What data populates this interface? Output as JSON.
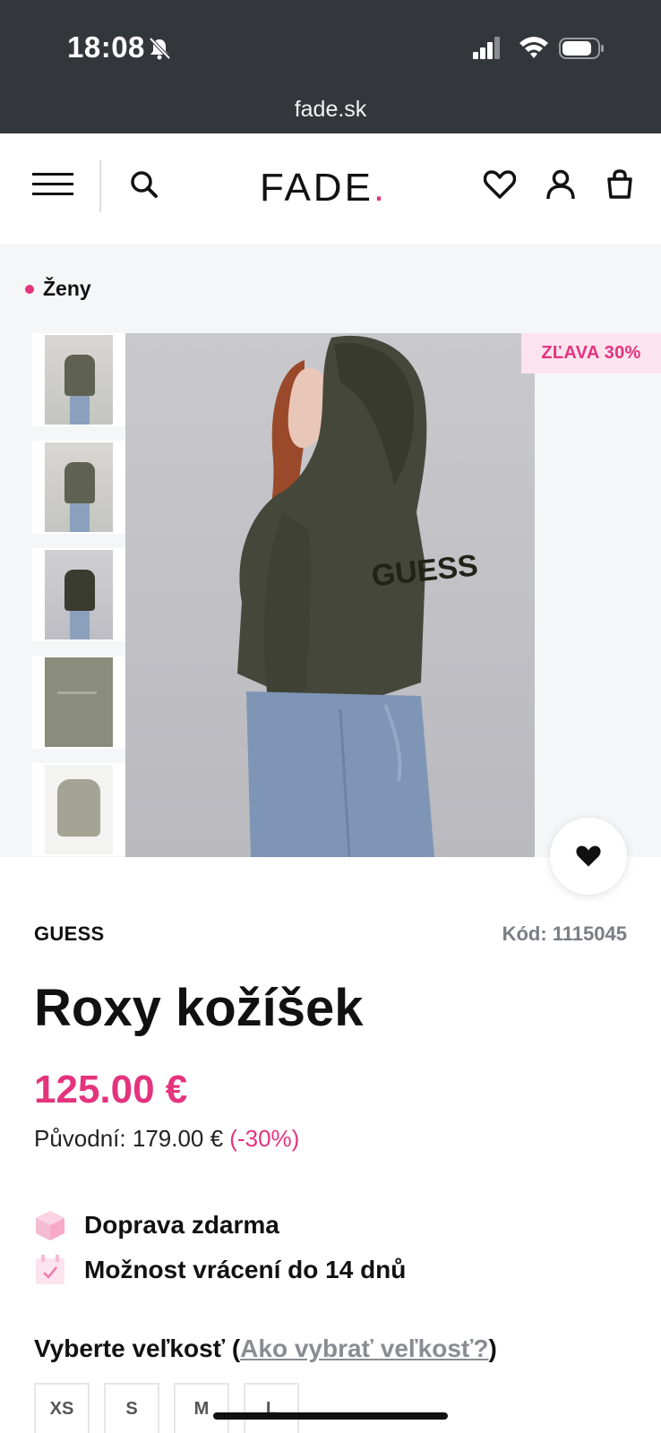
{
  "status_bar": {
    "time": "18:08",
    "url": "fade.sk",
    "icons": [
      "bell-muted-icon",
      "signal-icon",
      "wifi-icon",
      "battery-icon"
    ]
  },
  "header": {
    "logo_text": "FADE",
    "logo_dot": ".",
    "accent_color": "#e5337e",
    "icons": [
      "menu-icon",
      "search-icon",
      "heart-icon",
      "user-icon",
      "bag-icon"
    ]
  },
  "breadcrumb": {
    "label": "Ženy"
  },
  "gallery": {
    "sale_badge": "ZĽAVA 30%",
    "thumbnails_count": 5,
    "active_index": 2
  },
  "product": {
    "brand": "GUESS",
    "code": "Kód: 1115045",
    "title": "Roxy kožíšek",
    "price": "125.00 €",
    "original_prefix": "Původní: 179.00 €",
    "original_discount": "(-30%)"
  },
  "features": [
    {
      "icon": "box-icon",
      "label": "Doprava zdarma"
    },
    {
      "icon": "return-calendar-icon",
      "label": "Možnost vrácení do 14 dnů"
    }
  ],
  "size_selector": {
    "title_prefix": "Vyberte veľkosť (",
    "link": "Ako vybrať veľkosť?",
    "title_suffix": ")",
    "sizes": [
      "XS",
      "S",
      "M",
      "L"
    ]
  }
}
